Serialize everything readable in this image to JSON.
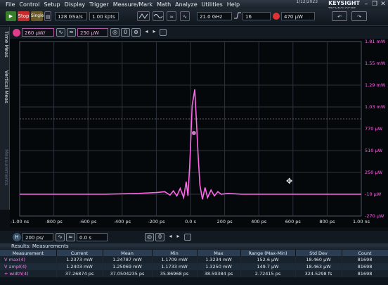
{
  "menu": [
    "File",
    "Control",
    "Setup",
    "Display",
    "Trigger",
    "Measure/Mark",
    "Math",
    "Analyze",
    "Utilities",
    "Help"
  ],
  "brand": {
    "name": "KEYSIGHT",
    "sub": "TECHNOLOGIES",
    "clock": "1/12/2023"
  },
  "toolbar": {
    "stop_label": "Stop",
    "single_label": "Single",
    "sample_rate": "128 GSa/s",
    "memory_depth": "1.00 kpts",
    "bandwidth": "21.0 GHz",
    "trigger_level": "16",
    "trigger_channel_level": "470 µW"
  },
  "channel": {
    "scale": "260 µW/",
    "offset": "250 µW",
    "color": "#ff5be3"
  },
  "side_tabs": [
    "Time Meas",
    "Vertical Meas",
    "Measurements"
  ],
  "chart_data": {
    "type": "line",
    "title": "",
    "xlabel": "",
    "ylabel": "",
    "x_unit": "ps",
    "y_unit": "mW",
    "x_ticks": [
      "-1.00 ns",
      "-800 ps",
      "-600 ps",
      "-400 ps",
      "-200 ps",
      "0.0 s",
      "200 ps",
      "400 ps",
      "600 ps",
      "800 ps",
      "1.00 ns"
    ],
    "y_ticks": [
      "1.81 mW",
      "1.55 mW",
      "1.29 mW",
      "1.03 mW",
      "770 µW",
      "510 µW",
      "250 µW",
      "-10 µW",
      "-270 µW"
    ],
    "xlim": [
      -1000,
      1000
    ],
    "ylim": [
      -0.27,
      1.81
    ],
    "grid": true,
    "series": [
      {
        "color": "#ff66e8",
        "x": [
          -1000,
          -500,
          -300,
          -200,
          -150,
          -120,
          -100,
          -80,
          -60,
          -40,
          -25,
          -15,
          -5,
          0,
          10,
          25,
          35,
          45,
          55,
          70,
          85,
          100,
          120,
          140,
          160,
          180,
          220,
          300,
          500,
          1000
        ],
        "y": [
          -0.01,
          -0.01,
          0.0,
          0.01,
          0.02,
          -0.02,
          0.03,
          -0.03,
          0.06,
          -0.05,
          0.14,
          -0.03,
          0.32,
          0.55,
          1.05,
          1.24,
          0.85,
          0.45,
          0.1,
          -0.07,
          0.07,
          -0.05,
          0.04,
          -0.03,
          0.02,
          -0.01,
          0.0,
          -0.01,
          -0.01,
          -0.01
        ]
      }
    ]
  },
  "timebase": {
    "scale": "200 ps/",
    "position": "0.0 s"
  },
  "results": {
    "title": "Results: Measurements",
    "headers": [
      "Measurement",
      "Current",
      "Mean",
      "Min",
      "Max",
      "Range (Max-Min)",
      "Std Dev",
      "Count"
    ],
    "rows": [
      [
        "V max(4)",
        "1.2373 mW",
        "1.24787 mW",
        "1.1709 mW",
        "1.3234 mW",
        "152.6 µW",
        "18.460 µW",
        "81698"
      ],
      [
        "V ampl(4)",
        "1.2403 mW",
        "1.25069 mW",
        "1.1733 mW",
        "1.3250 mW",
        "149.7 µW",
        "18.463 µW",
        "81698"
      ],
      [
        "+ width(4)",
        "37.26874 ps",
        "37.0504235 ps",
        "35.86968 ps",
        "38.59384 ps",
        "2.72415 ps",
        "324.5298 fs",
        "81698"
      ]
    ]
  }
}
